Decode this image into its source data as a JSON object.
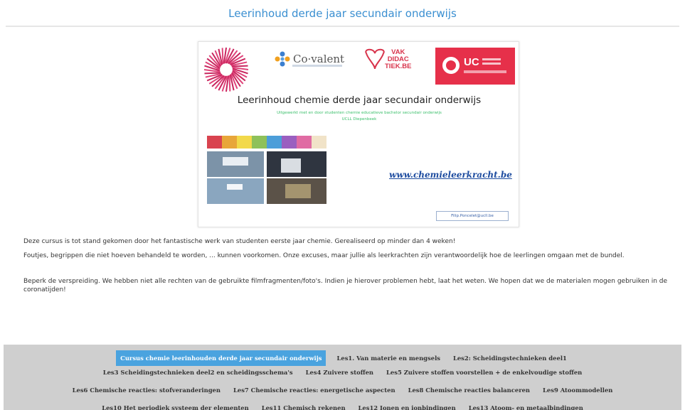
{
  "page": {
    "title": "Leerinhoud derde jaar secundair onderwijs"
  },
  "banner": {
    "covalent_text": "Co·valent",
    "vak_text": [
      "VAK",
      "DIDAC",
      "TIEK.BE"
    ],
    "ucll_text": "UC",
    "heading": "Leerinhoud chemie derde jaar secundair onderwijs",
    "subline1": "Uitgewerkt met en door studenten chemie educatieve bachelor secundair onderwijs",
    "subline2": "UCLL Diepenbeek",
    "url": "www.chemieleerkracht.be",
    "email": "Filip.Poncelet@ucll.be"
  },
  "paragraphs": [
    "Deze cursus is tot stand gekomen door het fantastische werk van studenten eerste jaar chemie. Gerealiseerd op minder dan 4 weken!",
    "Foutjes, begrippen die niet hoeven behandeld te worden, ... kunnen voorkomen. Onze excuses, maar jullie als leerkrachten zijn verantwoordelijk hoe de leerlingen omgaan met de bundel.",
    "Beperk de verspreiding. We hebben niet alle rechten van de gebruikte filmfragmenten/foto's. Indien je hierover problemen hebt, laat het weten. We hopen dat we de materialen mogen gebruiken in de coronatijden!"
  ],
  "nav": {
    "rows": [
      [
        "Cursus chemie leerinhouden derde jaar secundair onderwijs",
        "Les1. Van materie en mengsels",
        "Les2: Scheidingstechnieken deel1"
      ],
      [
        "Les3 Scheidingstechnieken deel2 en scheidingsschema's",
        "Les4 Zuivere stoffen",
        "Les5 Zuivere stoffen voorstellen + de enkelvoudige stoffen"
      ],
      [
        "Les6 Chemische reacties: stofveranderingen",
        "Les7 Chemische reacties: energetische aspecten",
        "Les8 Chemische reacties balanceren",
        "Les9 Atoommodellen"
      ],
      [
        "Les10 Het periodiek systeem der elementen",
        "Les11 Chemisch rekenen",
        "Les12 Ionen en ionbindingen",
        "Les13 Atoom- en metaalbindingen"
      ]
    ],
    "active_color": "#4aa3df"
  }
}
